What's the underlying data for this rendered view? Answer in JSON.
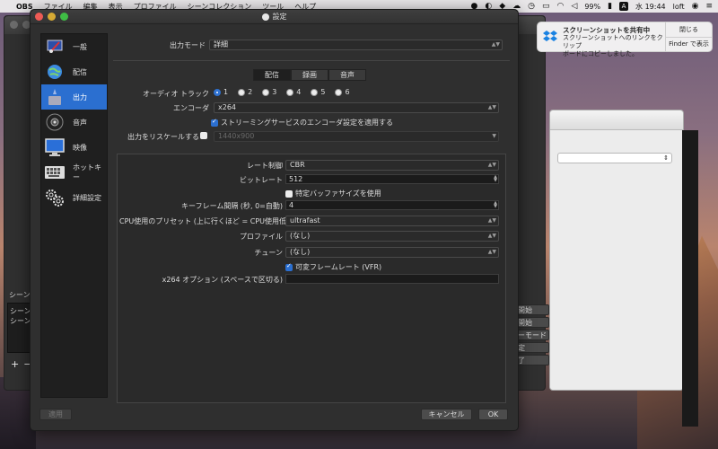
{
  "menubar": {
    "app_name": "OBS",
    "menus": [
      "ファイル",
      "編集",
      "表示",
      "プロファイル",
      "シーンコレクション",
      "ツール",
      "ヘルプ"
    ],
    "battery": "99%",
    "input_indicator": "A",
    "clock": "水 19:44",
    "user": "loft"
  },
  "notification": {
    "title": "スクリーンショットを共有中",
    "body_line1": "スクリーンショットへのリンクをクリップ",
    "body_line2": "ボードにコピーしました。",
    "close_label": "閉じる",
    "finder_label": "Finder で表示"
  },
  "main_window": {
    "scene_label": "シーン",
    "scenes": [
      "シーン",
      "シーン"
    ],
    "add": "+",
    "remove": "−",
    "right_buttons": [
      "開始",
      "開始",
      "ーモード",
      "定",
      "了"
    ]
  },
  "settings": {
    "title": "設定",
    "sidebar": [
      {
        "label": "一般",
        "icon": "general-icon",
        "active": false
      },
      {
        "label": "配信",
        "icon": "stream-globe-icon",
        "active": false
      },
      {
        "label": "出力",
        "icon": "output-icon",
        "active": true
      },
      {
        "label": "音声",
        "icon": "audio-speaker-icon",
        "active": false
      },
      {
        "label": "映像",
        "icon": "video-monitor-icon",
        "active": false
      },
      {
        "label": "ホットキー",
        "icon": "keyboard-icon",
        "active": false
      },
      {
        "label": "詳細設定",
        "icon": "gears-icon",
        "active": false
      }
    ],
    "output_mode_label": "出力モード",
    "output_mode_value": "詳細",
    "tabs": [
      {
        "label": "配信",
        "active": true
      },
      {
        "label": "録画",
        "active": false
      },
      {
        "label": "音声",
        "active": false
      }
    ],
    "audio_track_label": "オーディオ トラック",
    "audio_tracks": [
      "1",
      "2",
      "3",
      "4",
      "5",
      "6"
    ],
    "audio_track_selected": "1",
    "encoder_label": "エンコーダ",
    "encoder_value": "x264",
    "enforce_label": "ストリーミングサービスのエンコーダ設定を適用する",
    "rescale_label": "出力をリスケールする",
    "rescale_value": "1440x900",
    "rate_control_label": "レート制御",
    "rate_control_value": "CBR",
    "bitrate_label": "ビットレート",
    "bitrate_value": "512",
    "custom_buffer_label": "特定バッファサイズを使用",
    "keyframe_label": "キーフレーム間隔 (秒, 0=自動)",
    "keyframe_value": "4",
    "preset_label": "CPU使用のプリセット (上に行くほど = CPU使用低い)",
    "preset_value": "ultrafast",
    "profile_label": "プロファイル",
    "profile_value": "(なし)",
    "tune_label": "チューン",
    "tune_value": "(なし)",
    "vfr_label": "可変フレームレート (VFR)",
    "x264_opts_label": "x264 オプション (スペースで区切る)",
    "x264_opts_value": "",
    "apply_label": "適用",
    "cancel_label": "キャンセル",
    "ok_label": "OK"
  }
}
